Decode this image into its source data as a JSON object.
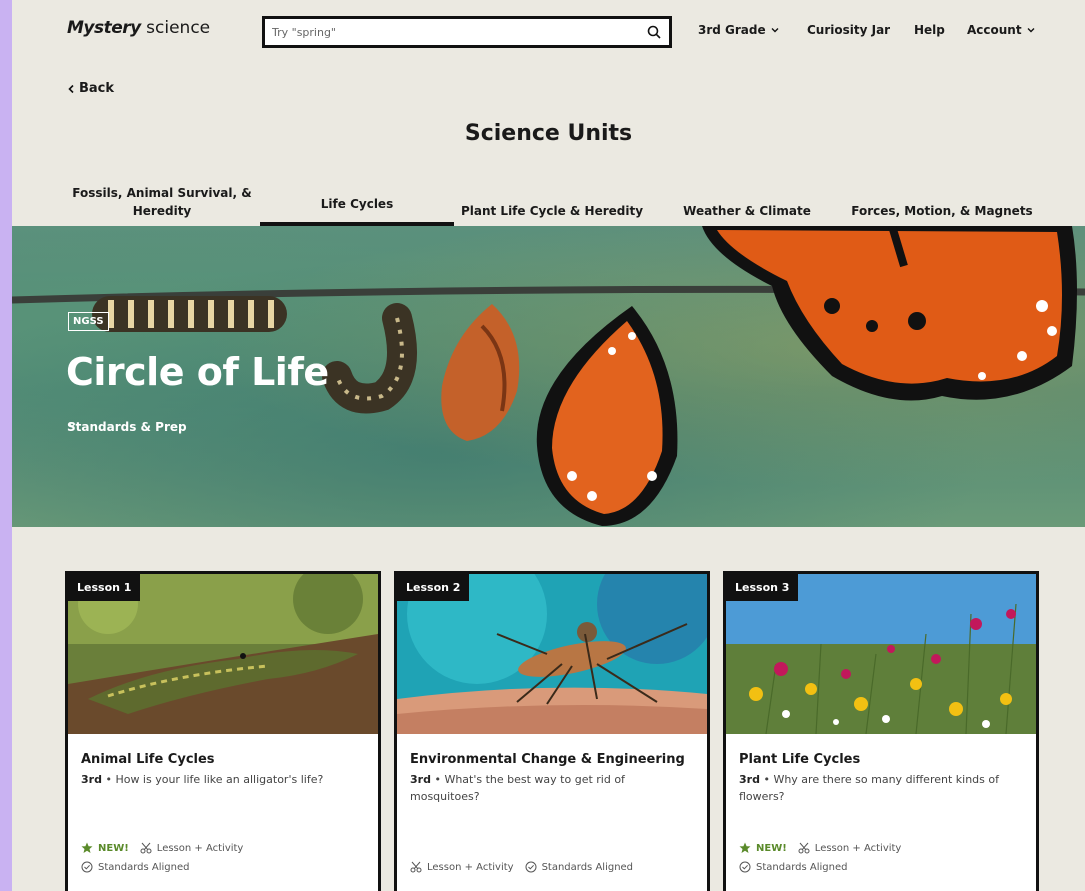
{
  "header": {
    "logo_bold": "Mystery",
    "logo_light": "science",
    "search_placeholder": "Try \"spring\"",
    "nav": {
      "grade": "3rd Grade",
      "curiosity": "Curiosity Jar",
      "help": "Help",
      "account": "Account"
    }
  },
  "back_label": "Back",
  "page_title": "Science Units",
  "tabs": [
    {
      "label": "Fossils, Animal Survival, & Heredity",
      "active": false
    },
    {
      "label": "Life Cycles",
      "active": true
    },
    {
      "label": "Plant Life Cycle & Heredity",
      "active": false
    },
    {
      "label": "Weather & Climate",
      "active": false
    },
    {
      "label": "Forces, Motion, & Magnets",
      "active": false
    }
  ],
  "hero": {
    "badge": "NGSS",
    "title": "Circle of Life",
    "standards_prep": "Standards & Prep"
  },
  "lessons": [
    {
      "tag": "Lesson 1",
      "title": "Animal Life Cycles",
      "grade": "3rd",
      "question": "How is your life like an alligator's life?",
      "new_label": "NEW!",
      "type": "Lesson + Activity",
      "standards": "Standards Aligned"
    },
    {
      "tag": "Lesson 2",
      "title": "Environmental Change & Engineering",
      "grade": "3rd",
      "question": "What's the best way to get rid of mosquitoes?",
      "type": "Lesson + Activity",
      "standards": "Standards Aligned"
    },
    {
      "tag": "Lesson 3",
      "title": "Plant Life Cycles",
      "grade": "3rd",
      "question": "Why are there so many different kinds of flowers?",
      "new_label": "NEW!",
      "type": "Lesson + Activity",
      "standards": "Standards Aligned"
    }
  ],
  "colors": {
    "page_bg": "#ebe9e1",
    "border_bg": "#c9b2f2",
    "new_green": "#5a8a2a"
  }
}
